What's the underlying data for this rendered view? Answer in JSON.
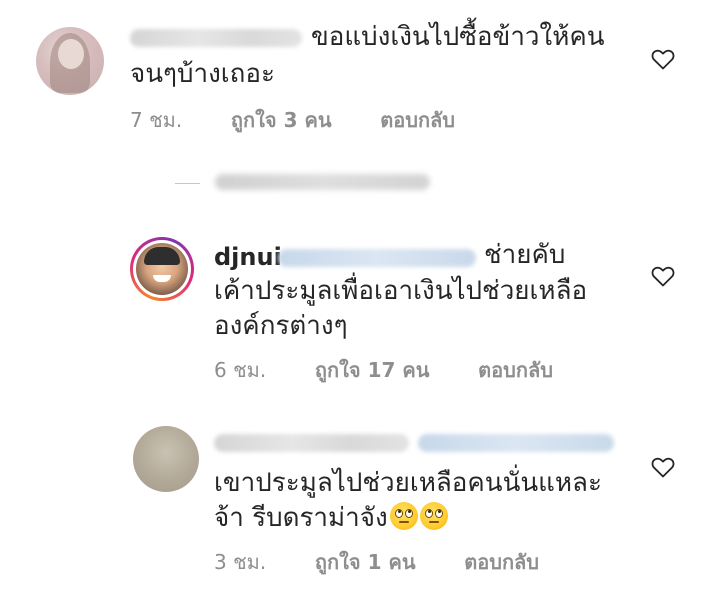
{
  "comments": [
    {
      "text_line1": "ขอแบ่งเงินไปซื้อข้าวให้คน",
      "text_line2": "จนๆบ้างเถอะ",
      "time": "7 ชม.",
      "likes": "ถูกใจ 3 คน",
      "reply": "ตอบกลับ"
    },
    {
      "username": "djnui",
      "text_line1": "ช่ายคับ",
      "text_line2": "เค้าประมูลเพื่อเอาเงินไปช่วยเหลือ",
      "text_line3": "องค์กรต่างๆ",
      "time": "6 ชม.",
      "likes": "ถูกใจ 17 คน",
      "reply": "ตอบกลับ"
    },
    {
      "text_line1": "เขาประมูลไปช่วยเหลือคนนั่นแหละ",
      "text_line2": "จ้า รีบดราม่าจัง",
      "emoji": [
        "face-with-rolling-eyes-icon",
        "face-with-rolling-eyes-icon"
      ],
      "time": "3 ชม.",
      "likes": "ถูกใจ 1 คน",
      "reply": "ตอบกลับ"
    }
  ],
  "colors": {
    "text": "#262626",
    "meta": "#8e8e8e",
    "mention": "#c7d8ea",
    "story_ring": [
      "#f58529",
      "#dd2a7b",
      "#8134af"
    ]
  }
}
